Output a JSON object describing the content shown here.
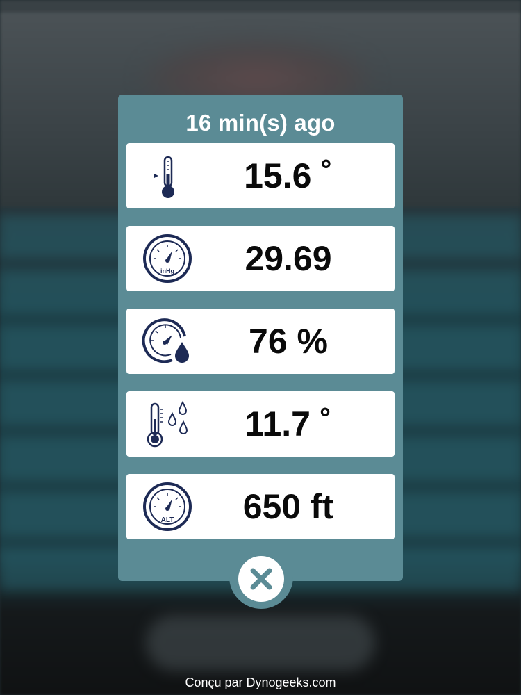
{
  "modal": {
    "title": "16 min(s) ago",
    "readings": [
      {
        "id": "temperature",
        "value": "15.6 ˚",
        "icon": "thermometer-icon"
      },
      {
        "id": "pressure",
        "value": "29.69",
        "icon": "barometer-inhg-icon",
        "icon_label": "inHg"
      },
      {
        "id": "humidity",
        "value": "76 %",
        "icon": "humidity-gauge-icon"
      },
      {
        "id": "dew-point",
        "value": "11.7 ˚",
        "icon": "dew-point-icon"
      },
      {
        "id": "altitude",
        "value": "650 ft",
        "icon": "altimeter-icon",
        "icon_label": "ALT"
      }
    ],
    "close_icon": "close-icon"
  },
  "footer": {
    "credit": "Conçu par Dynogeeks.com"
  },
  "colors": {
    "modal_bg": "#5b8b95",
    "icon_navy": "#1d2a55",
    "close_teal": "#5b8b95"
  }
}
